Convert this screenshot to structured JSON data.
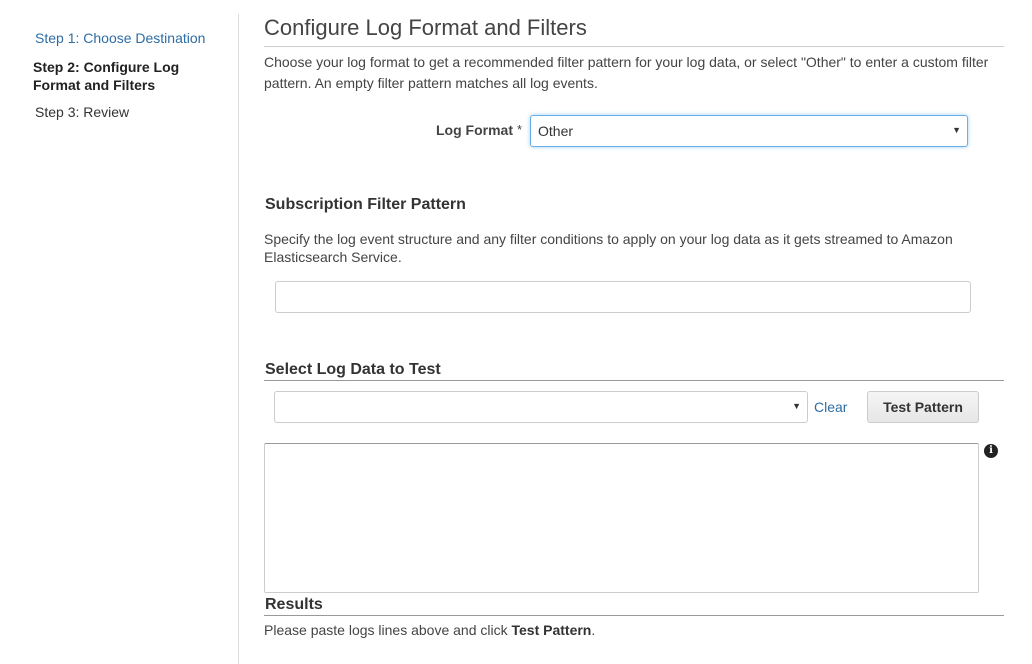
{
  "sidebar": {
    "steps": [
      {
        "label": "Step 1: Choose Destination"
      },
      {
        "label": "Step 2: Configure Log Format and Filters"
      },
      {
        "label": "Step 3: Review"
      }
    ]
  },
  "main": {
    "title": "Configure Log Format and Filters",
    "intro": "Choose your log format to get a recommended filter pattern for your log data, or select \"Other\" to enter a custom filter pattern. An empty filter pattern matches all log events.",
    "log_format": {
      "label": "Log Format",
      "required_marker": "*",
      "selected": "Other"
    },
    "subscription": {
      "heading": "Subscription Filter Pattern",
      "description": "Specify the log event structure and any filter conditions to apply on your log data as it gets streamed to Amazon Elasticsearch Service.",
      "value": ""
    },
    "test": {
      "heading": "Select Log Data to Test",
      "selected": "",
      "clear_label": "Clear",
      "button_label": "Test Pattern",
      "info_glyph": "i"
    },
    "results": {
      "heading": "Results",
      "text_before": "Please paste logs lines above and click ",
      "text_bold": "Test Pattern",
      "text_after": "."
    }
  },
  "colors": {
    "link": "#2e6da4",
    "focus_border": "#66afe9"
  }
}
